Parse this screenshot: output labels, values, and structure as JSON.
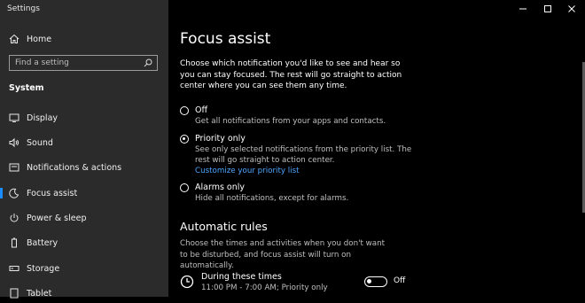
{
  "window": {
    "app_title": "Settings",
    "controls": [
      "minimize",
      "maximize",
      "close"
    ]
  },
  "sidebar": {
    "home_label": "Home",
    "search_placeholder": "Find a setting",
    "section_title": "System",
    "items": [
      {
        "label": "Display",
        "icon": "display-icon"
      },
      {
        "label": "Sound",
        "icon": "speaker-icon"
      },
      {
        "label": "Notifications & actions",
        "icon": "notification-icon"
      },
      {
        "label": "Focus assist",
        "icon": "moon-icon",
        "active": true
      },
      {
        "label": "Power & sleep",
        "icon": "power-icon"
      },
      {
        "label": "Battery",
        "icon": "battery-icon"
      },
      {
        "label": "Storage",
        "icon": "storage-icon"
      },
      {
        "label": "Tablet",
        "icon": "tablet-icon"
      }
    ]
  },
  "main": {
    "title": "Focus assist",
    "intro": "Choose which notification you'd like to see and hear so you can stay focused. The rest will go straight to action center where you can see them any time.",
    "options": [
      {
        "label": "Off",
        "desc": "Get all notifications from your apps and contacts.",
        "checked": false
      },
      {
        "label": "Priority only",
        "desc": "See only selected notifications from the priority list. The rest will go straight to action center.",
        "link": "Customize your priority list",
        "checked": true
      },
      {
        "label": "Alarms only",
        "desc": "Hide all notifications, except for alarms.",
        "checked": false
      }
    ],
    "automatic_rules": {
      "title": "Automatic rules",
      "desc": "Choose the times and activities when you don't want to be disturbed, and focus assist will turn on automatically.",
      "rule": {
        "title": "During these times",
        "subtitle": "11:00 PM - 7:00 AM; Priority only",
        "toggle_state": "Off",
        "toggle_on": false
      }
    }
  },
  "colors": {
    "sidebar_bg": "#2b2b2b",
    "main_bg": "#000000",
    "accent": "#1a8cff",
    "link": "#4da6ff"
  }
}
